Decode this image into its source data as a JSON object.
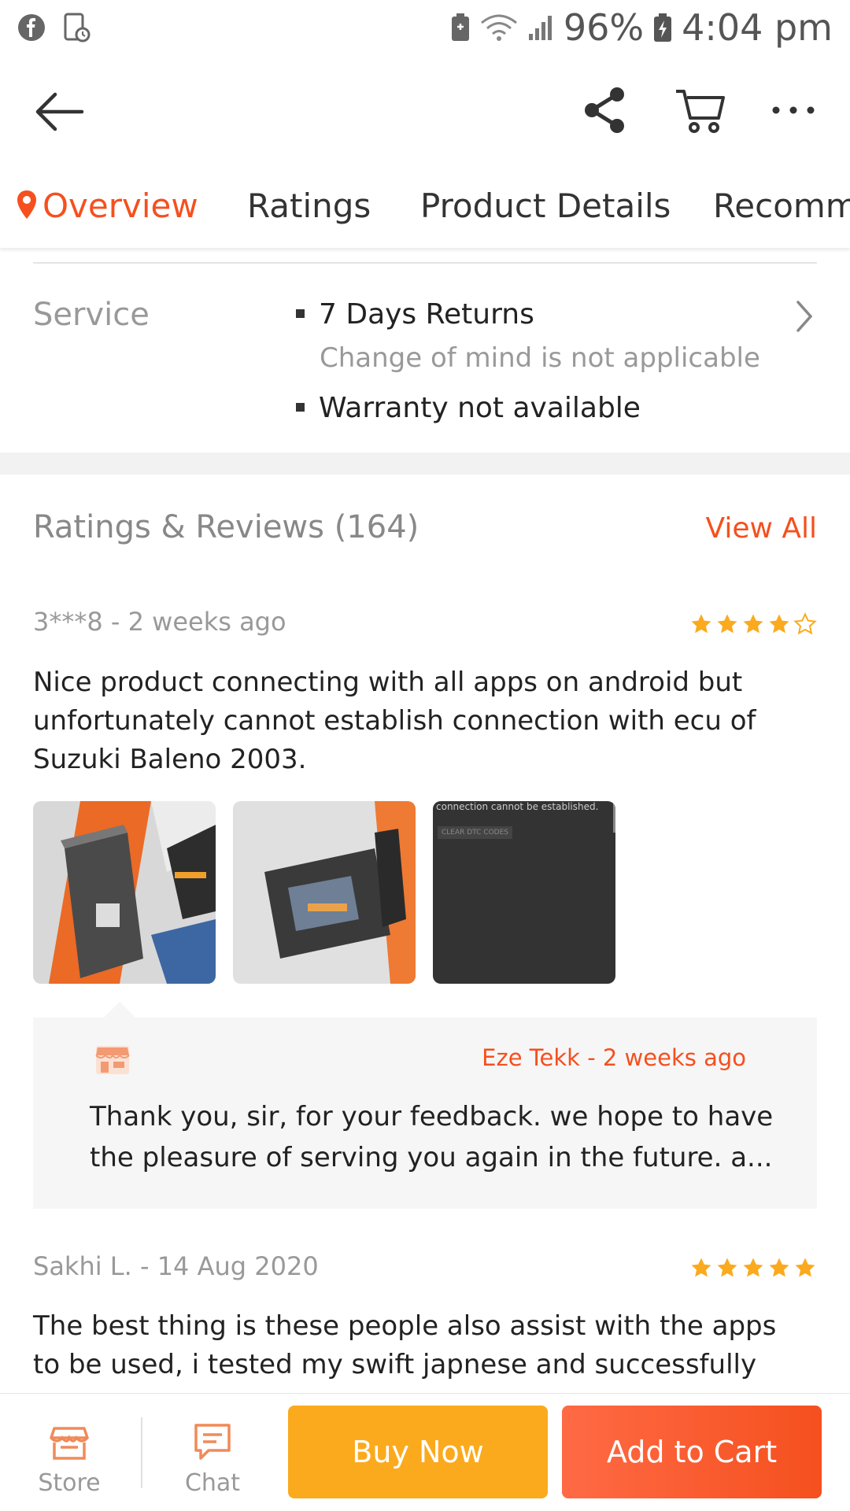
{
  "status_bar": {
    "battery": "96%",
    "time": "4:04 pm",
    "icons": [
      "facebook-icon",
      "app-notification-icon",
      "battery-saver-icon",
      "wifi-icon",
      "signal-icon",
      "charging-battery-icon"
    ]
  },
  "app_bar": {
    "icons": [
      "back-arrow-icon",
      "share-icon",
      "cart-icon",
      "more-icon"
    ]
  },
  "tabs": [
    {
      "label": "Overview",
      "active": true
    },
    {
      "label": "Ratings",
      "active": false
    },
    {
      "label": "Product Details",
      "active": false
    },
    {
      "label": "Recomm",
      "active": false
    }
  ],
  "service": {
    "label": "Service",
    "items": [
      {
        "title": "7 Days Returns",
        "subtitle": "Change of mind is not applicable"
      },
      {
        "title": "Warranty not available",
        "subtitle": ""
      }
    ]
  },
  "reviews": {
    "title": "Ratings & Reviews (164)",
    "view_all": "View All",
    "list": [
      {
        "meta": "3***8 - 2  weeks ago",
        "rating": 4,
        "text": "Nice product connecting with all apps on android but unfortunately cannot establish connection with ecu of Suzuki Baleno 2003.",
        "photo_caption_1": "connection cannot be established.",
        "photo_caption_2": "CLEAR DTC CODES",
        "reply": {
          "meta": "Eze Tekk - 2  weeks ago",
          "text": "Thank you, sir, for your feedback. we hope to have the pleasure of serving you again in the future. a..."
        }
      },
      {
        "meta": "Sakhi L. - 14 Aug 2020",
        "rating": 5,
        "text": "The best thing is these people also assist with the apps to be used, i tested my swift japnese and successfully"
      }
    ]
  },
  "bottom_bar": {
    "store_label": "Store",
    "chat_label": "Chat",
    "buy_now": "Buy Now",
    "add_to_cart": "Add to Cart"
  },
  "colors": {
    "accent": "#f5501e",
    "buy_now": "#fbaa1e",
    "star": "#fbaa1e"
  }
}
